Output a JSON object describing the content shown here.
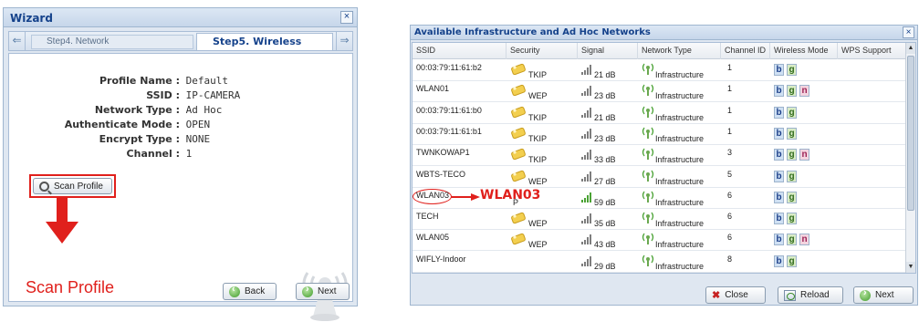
{
  "wizard": {
    "title": "Wizard",
    "close": "×",
    "step_prev": "Step4. Network",
    "step_current": "Step5. Wireless",
    "nav_left": "⇐",
    "nav_right": "⇒",
    "fields": [
      {
        "label": "Profile Name :",
        "value": "Default"
      },
      {
        "label": "SSID :",
        "value": "IP-CAMERA"
      },
      {
        "label": "Network Type :",
        "value": "Ad Hoc"
      },
      {
        "label": "Authenticate Mode :",
        "value": "OPEN"
      },
      {
        "label": "Encrypt Type :",
        "value": "NONE"
      },
      {
        "label": "Channel :",
        "value": "1"
      }
    ],
    "scan_button": "Scan Profile",
    "scan_caption": "Scan Profile",
    "back_button": "Back",
    "next_button": "Next"
  },
  "networks": {
    "title": "Available Infrastructure and Ad Hoc Networks",
    "close": "×",
    "columns": [
      "SSID",
      "Security",
      "Signal",
      "Network Type",
      "Channel ID",
      "Wireless Mode",
      "WPS Support"
    ],
    "rows": [
      {
        "ssid": "00:03:79:11:61:b2",
        "security": "TKIP",
        "signal": "21 dB",
        "type": "Infrastructure",
        "channel": "1",
        "modes": [
          "b",
          "g"
        ]
      },
      {
        "ssid": "WLAN01",
        "security": "WEP",
        "signal": "23 dB",
        "type": "Infrastructure",
        "channel": "1",
        "modes": [
          "b",
          "g",
          "n"
        ]
      },
      {
        "ssid": "00:03:79:11:61:b0",
        "security": "TKIP",
        "signal": "21 dB",
        "type": "Infrastructure",
        "channel": "1",
        "modes": [
          "b",
          "g"
        ]
      },
      {
        "ssid": "00:03:79:11:61:b1",
        "security": "TKIP",
        "signal": "23 dB",
        "type": "Infrastructure",
        "channel": "1",
        "modes": [
          "b",
          "g"
        ]
      },
      {
        "ssid": "TWNKOWAP1",
        "security": "TKIP",
        "signal": "33 dB",
        "type": "Infrastructure",
        "channel": "3",
        "modes": [
          "b",
          "g",
          "n"
        ]
      },
      {
        "ssid": "WBTS-TECO",
        "security": "WEP",
        "signal": "27 dB",
        "type": "Infrastructure",
        "channel": "5",
        "modes": [
          "b",
          "g"
        ]
      },
      {
        "ssid": "WLAN03",
        "security": "P",
        "signal": "59 dB",
        "type": "Infrastructure",
        "channel": "6",
        "modes": [
          "b",
          "g"
        ]
      },
      {
        "ssid": "TECH",
        "security": "WEP",
        "signal": "35 dB",
        "type": "Infrastructure",
        "channel": "6",
        "modes": [
          "b",
          "g"
        ]
      },
      {
        "ssid": "WLAN05",
        "security": "WEP",
        "signal": "43 dB",
        "type": "Infrastructure",
        "channel": "6",
        "modes": [
          "b",
          "g",
          "n"
        ]
      },
      {
        "ssid": "WIFLY-Indoor",
        "security": "",
        "signal": "29 dB",
        "type": "Infrastructure",
        "channel": "8",
        "modes": [
          "b",
          "g"
        ]
      }
    ],
    "highlight_label": "WLAN03",
    "close_button": "Close",
    "reload_button": "Reload",
    "next_button": "Next",
    "scroll_up": "▲",
    "scroll_down": "▼"
  },
  "colors": {
    "accent_red": "#e0201c",
    "title_blue": "#15428b"
  }
}
